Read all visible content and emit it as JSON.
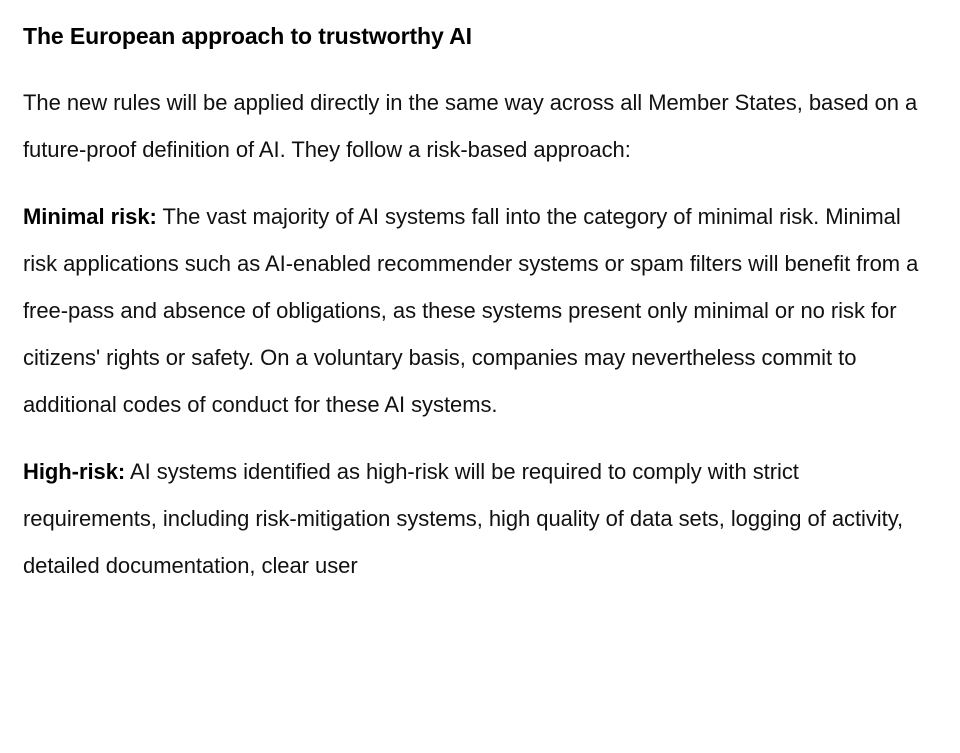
{
  "document": {
    "title": "The European approach to trustworthy AI",
    "paragraphs": [
      {
        "id": "intro",
        "lead_in": "",
        "text": "The new rules will be applied directly in the same way across all Member States, based on a future-proof definition of AI. They follow a risk-based approach:"
      },
      {
        "id": "minimal-risk",
        "lead_in": "Minimal risk:",
        "text": " The vast majority of AI systems fall into the category of minimal risk. Minimal risk applications such as AI-enabled recommender systems or spam filters will benefit from a free-pass and absence of obligations, as these systems present only minimal or no risk for citizens' rights or safety. On a voluntary basis, companies may nevertheless commit to additional codes of conduct for these AI systems."
      },
      {
        "id": "high-risk",
        "lead_in": "High-risk:",
        "text": " AI systems identified as high-risk will be required to comply with strict requirements, including risk-mitigation systems, high quality of data sets, logging of activity, detailed documentation, clear user"
      }
    ]
  },
  "colors": {
    "background": "#ffffff",
    "body_text": "#111111",
    "heading_text": "#000000"
  }
}
